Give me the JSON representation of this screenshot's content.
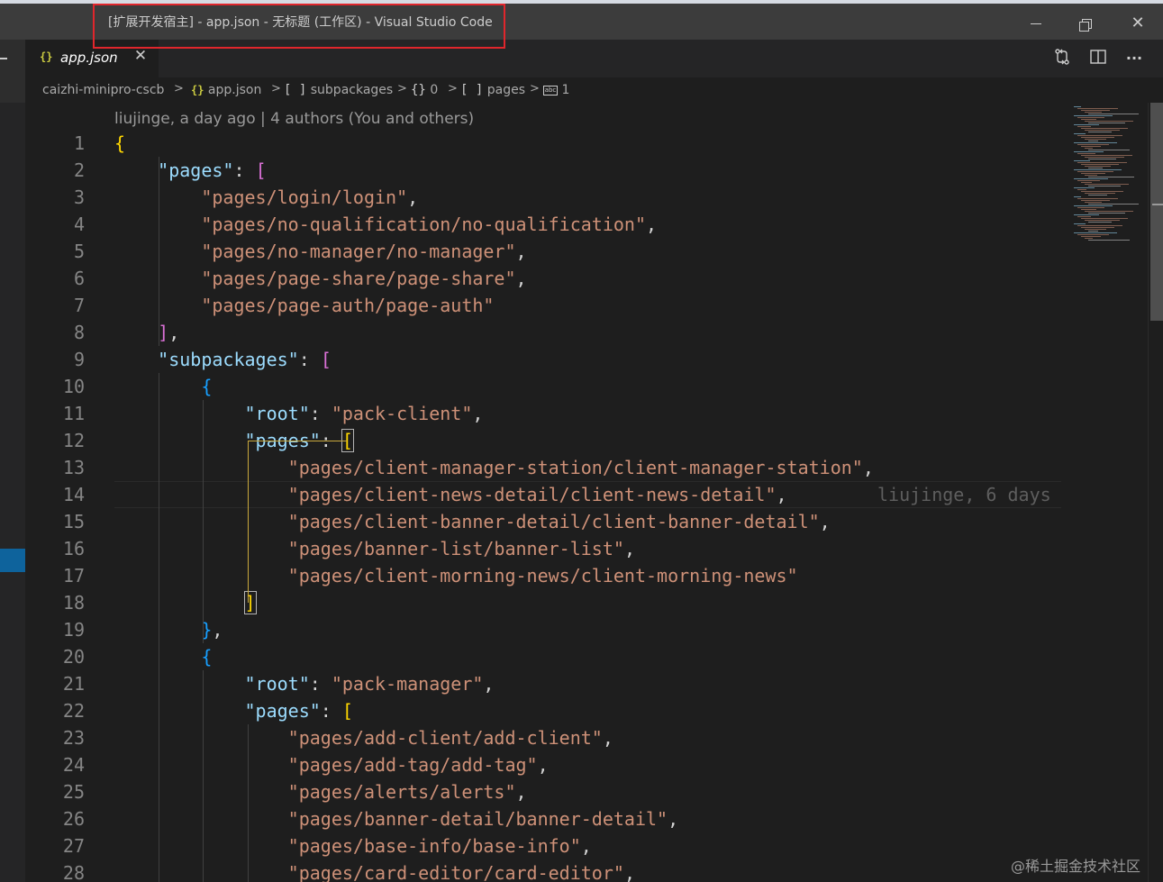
{
  "window": {
    "title": "[扩展开发宿主] - app.json - 无标题 (工作区) - Visual Studio Code",
    "controls": {
      "minimize": "minimize",
      "maximize": "restore",
      "close": "✕"
    }
  },
  "tab": {
    "icon": "{}",
    "label": "app.json",
    "close": "✕"
  },
  "toolbar": {
    "compare_icon": "compare-changes-icon",
    "split_icon": "split-editor-icon",
    "more_label": "···"
  },
  "breadcrumb": {
    "items": [
      {
        "label": "caizhi-minipro-cscb",
        "icon": ""
      },
      {
        "label": "app.json",
        "icon": "{}"
      },
      {
        "label": "subpackages",
        "icon": "[ ]"
      },
      {
        "label": "0",
        "icon": "{}"
      },
      {
        "label": "pages",
        "icon": "[ ]"
      },
      {
        "label": "1",
        "icon": "abc"
      }
    ],
    "separator": ">"
  },
  "codelens": "liujinge, a day ago | 4 authors (You and others)",
  "blame_inline": "liujinge, 6 days",
  "code_lines": [
    {
      "n": "1",
      "segs": [
        [
          "{",
          "b1"
        ]
      ]
    },
    {
      "n": "2",
      "segs": [
        [
          "    ",
          ""
        ],
        [
          "\"pages\"",
          "k"
        ],
        [
          ": ",
          "p"
        ],
        [
          "[",
          "b2"
        ]
      ]
    },
    {
      "n": "3",
      "segs": [
        [
          "        ",
          ""
        ],
        [
          "\"pages/login/login\"",
          "s"
        ],
        [
          ",",
          "p"
        ]
      ]
    },
    {
      "n": "4",
      "segs": [
        [
          "        ",
          ""
        ],
        [
          "\"pages/no-qualification/no-qualification\"",
          "s"
        ],
        [
          ",",
          "p"
        ]
      ]
    },
    {
      "n": "5",
      "segs": [
        [
          "        ",
          ""
        ],
        [
          "\"pages/no-manager/no-manager\"",
          "s"
        ],
        [
          ",",
          "p"
        ]
      ]
    },
    {
      "n": "6",
      "segs": [
        [
          "        ",
          ""
        ],
        [
          "\"pages/page-share/page-share\"",
          "s"
        ],
        [
          ",",
          "p"
        ]
      ]
    },
    {
      "n": "7",
      "segs": [
        [
          "        ",
          ""
        ],
        [
          "\"pages/page-auth/page-auth\"",
          "s"
        ]
      ]
    },
    {
      "n": "8",
      "segs": [
        [
          "    ",
          ""
        ],
        [
          "]",
          "b2"
        ],
        [
          ",",
          "p"
        ]
      ]
    },
    {
      "n": "9",
      "segs": [
        [
          "    ",
          ""
        ],
        [
          "\"subpackages\"",
          "k"
        ],
        [
          ": ",
          "p"
        ],
        [
          "[",
          "b2"
        ]
      ]
    },
    {
      "n": "10",
      "segs": [
        [
          "        ",
          ""
        ],
        [
          "{",
          "b3"
        ]
      ]
    },
    {
      "n": "11",
      "segs": [
        [
          "            ",
          ""
        ],
        [
          "\"root\"",
          "k"
        ],
        [
          ": ",
          "p"
        ],
        [
          "\"pack-client\"",
          "s"
        ],
        [
          ",",
          "p"
        ]
      ]
    },
    {
      "n": "12",
      "segs": [
        [
          "            ",
          ""
        ],
        [
          "\"pages\"",
          "k"
        ],
        [
          ": ",
          "p"
        ],
        [
          "[",
          "bm"
        ]
      ]
    },
    {
      "n": "13",
      "segs": [
        [
          "                ",
          ""
        ],
        [
          "\"pages/client-manager-station/client-manager-station\"",
          "s"
        ],
        [
          ",",
          "p"
        ]
      ]
    },
    {
      "n": "14",
      "segs": [
        [
          "                ",
          ""
        ],
        [
          "\"pages/client-news-detail/client-news-detail\"",
          "s"
        ],
        [
          ",",
          "p"
        ]
      ]
    },
    {
      "n": "15",
      "segs": [
        [
          "                ",
          ""
        ],
        [
          "\"pages/client-banner-detail/client-banner-detail\"",
          "s"
        ],
        [
          ",",
          "p"
        ]
      ]
    },
    {
      "n": "16",
      "segs": [
        [
          "                ",
          ""
        ],
        [
          "\"pages/banner-list/banner-list\"",
          "s"
        ],
        [
          ",",
          "p"
        ]
      ]
    },
    {
      "n": "17",
      "segs": [
        [
          "                ",
          ""
        ],
        [
          "\"pages/client-morning-news/client-morning-news\"",
          "s"
        ]
      ]
    },
    {
      "n": "18",
      "segs": [
        [
          "            ",
          ""
        ],
        [
          "]",
          "bm"
        ]
      ]
    },
    {
      "n": "19",
      "segs": [
        [
          "        ",
          ""
        ],
        [
          "}",
          "b3"
        ],
        [
          ",",
          "p"
        ]
      ]
    },
    {
      "n": "20",
      "segs": [
        [
          "        ",
          ""
        ],
        [
          "{",
          "b3"
        ]
      ]
    },
    {
      "n": "21",
      "segs": [
        [
          "            ",
          ""
        ],
        [
          "\"root\"",
          "k"
        ],
        [
          ": ",
          "p"
        ],
        [
          "\"pack-manager\"",
          "s"
        ],
        [
          ",",
          "p"
        ]
      ]
    },
    {
      "n": "22",
      "segs": [
        [
          "            ",
          ""
        ],
        [
          "\"pages\"",
          "k"
        ],
        [
          ": ",
          "p"
        ],
        [
          "[",
          "b1"
        ]
      ]
    },
    {
      "n": "23",
      "segs": [
        [
          "                ",
          ""
        ],
        [
          "\"pages/add-client/add-client\"",
          "s"
        ],
        [
          ",",
          "p"
        ]
      ]
    },
    {
      "n": "24",
      "segs": [
        [
          "                ",
          ""
        ],
        [
          "\"pages/add-tag/add-tag\"",
          "s"
        ],
        [
          ",",
          "p"
        ]
      ]
    },
    {
      "n": "25",
      "segs": [
        [
          "                ",
          ""
        ],
        [
          "\"pages/alerts/alerts\"",
          "s"
        ],
        [
          ",",
          "p"
        ]
      ]
    },
    {
      "n": "26",
      "segs": [
        [
          "                ",
          ""
        ],
        [
          "\"pages/banner-detail/banner-detail\"",
          "s"
        ],
        [
          ",",
          "p"
        ]
      ]
    },
    {
      "n": "27",
      "segs": [
        [
          "                ",
          ""
        ],
        [
          "\"pages/base-info/base-info\"",
          "s"
        ],
        [
          ",",
          "p"
        ]
      ]
    },
    {
      "n": "28",
      "segs": [
        [
          "                ",
          ""
        ],
        [
          "\"pages/card-editor/card-editor\"",
          "s"
        ],
        [
          ",",
          "p"
        ]
      ]
    }
  ],
  "watermark": "@稀土掘金技术社区",
  "colors": {
    "title_highlight": "#e0262c",
    "key": "#9cdcfe",
    "string": "#ce9178",
    "bracket_gold": "#ffd700",
    "bracket_purple": "#da70d6",
    "bracket_blue": "#179fff"
  }
}
